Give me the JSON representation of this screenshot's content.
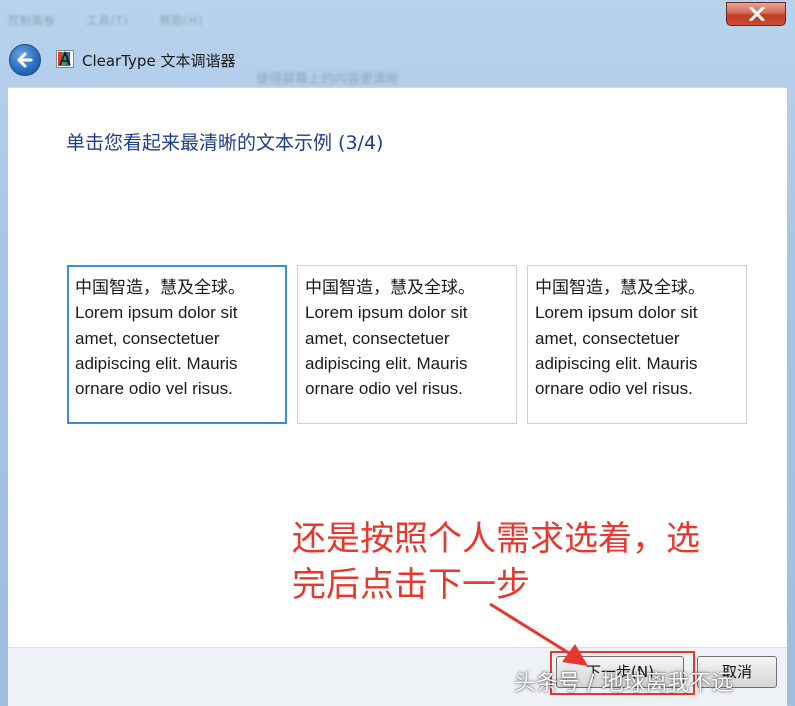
{
  "window": {
    "title": "ClearType 文本调谐器",
    "blurred_background": [
      "控制面板",
      "工具(T)",
      "帮助(H)"
    ],
    "blurred_subtitle": "使得屏幕上的内容更清晰"
  },
  "wizard": {
    "heading": "单击您看起来最清晰的文本示例 (3/4)",
    "samples": [
      {
        "line1": "中国智造，慧及全球。",
        "line2": "Lorem ipsum dolor sit",
        "line3": "amet, consectetuer",
        "line4": "adipiscing elit. Mauris",
        "line5": "ornare odio vel risus.",
        "selected": true
      },
      {
        "line1": "中国智造，慧及全球。",
        "line2": "Lorem ipsum dolor sit",
        "line3": "amet, consectetuer",
        "line4": "adipiscing elit. Mauris",
        "line5": "ornare odio vel risus.",
        "selected": false
      },
      {
        "line1": "中国智造，慧及全球。",
        "line2": "Lorem ipsum dolor sit",
        "line3": "amet, consectetuer",
        "line4": "adipiscing elit. Mauris",
        "line5": "ornare odio vel risus.",
        "selected": false
      }
    ]
  },
  "annotation": {
    "line1": "还是按照个人需求选着，选",
    "line2": "完后点击下一步",
    "color": "#e8372e"
  },
  "buttons": {
    "next_label": "下一步(N)",
    "cancel_label": "取消"
  },
  "watermark": "头条号 / 地球离我不远",
  "icons": {
    "back": "back-arrow-icon",
    "close": "close-icon",
    "app": "cleartype-icon"
  },
  "colors": {
    "heading": "#1e3f8a",
    "selected_border": "#3d8ed6",
    "close_button": "#c03c25"
  }
}
